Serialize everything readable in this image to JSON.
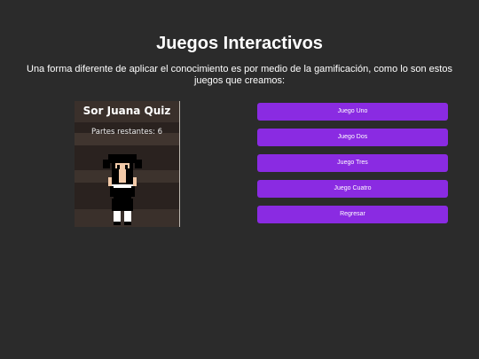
{
  "page": {
    "title": "Juegos Interactivos",
    "intro": "Una forma diferente de aplicar el conocimiento es por medio de la gamificación, como lo son estos juegos que creamos:"
  },
  "game_preview": {
    "title": "Sor Juana Quiz",
    "status": "Partes restantes: 6"
  },
  "menu": {
    "buttons": [
      "Juego Uno",
      "Juego Dos",
      "Juego Tres",
      "Juego Cuatro",
      "Regresar"
    ]
  },
  "colors": {
    "background": "#2b2b2b",
    "button": "#8a2be2",
    "text": "#ffffff"
  }
}
